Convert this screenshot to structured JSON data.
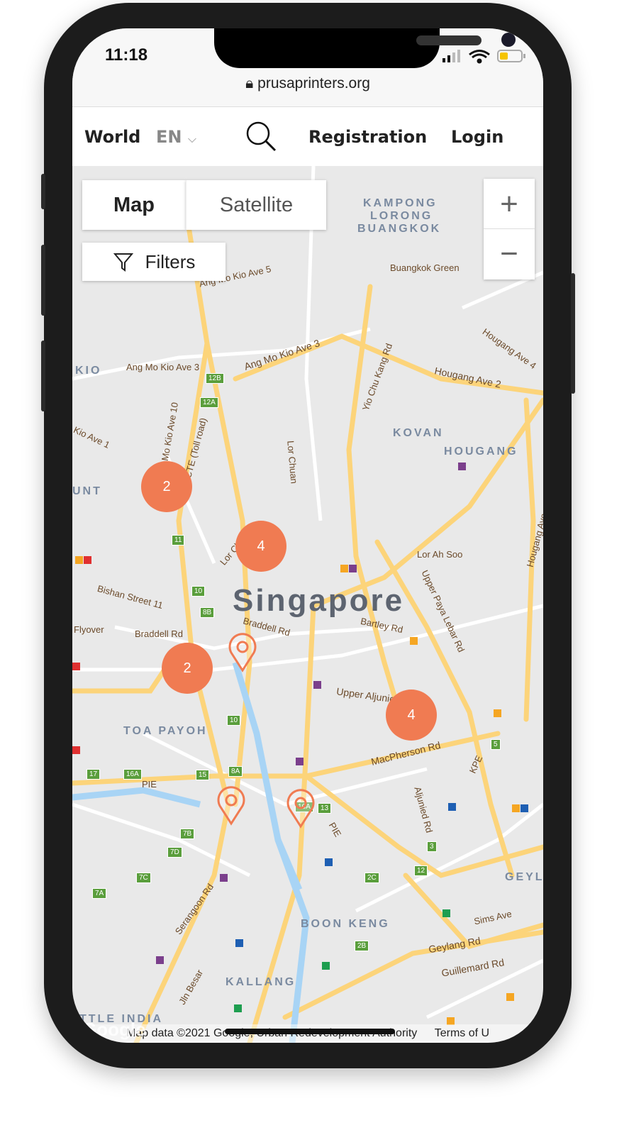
{
  "status": {
    "time": "11:18",
    "battery_color": "#f5c400"
  },
  "browser": {
    "url": "prusaprinters.org"
  },
  "header": {
    "region": "World",
    "language": "EN",
    "registration": "Registration",
    "login": "Login"
  },
  "map_controls": {
    "map": "Map",
    "satellite": "Satellite",
    "filters": "Filters",
    "zoom_in": "+",
    "zoom_out": "−"
  },
  "map": {
    "city": "Singapore",
    "areas": [
      "KAMPONG",
      "LORONG",
      "BUANGKOK",
      "KOVAN",
      "HOUGANG",
      "TOA PAYOH",
      "BOON KENG",
      "KALLANG",
      "GEYL",
      "KIO",
      "UNT",
      "TTLE INDIA"
    ],
    "roads": [
      "Ang Mo Kio Ave 5",
      "Ang Mo Kio Ave 3",
      "Ang Mo Kio Ave 3",
      "Buangkok Green",
      "Hougang Ave 4",
      "Hougang Ave 2",
      "Yio Chu Kang Rd",
      "CTE (Toll road)",
      "Ang Mo Kio Ave 10",
      "Kio Ave 1",
      "Lor Chuan",
      "Lor Chuan",
      "Lor Ah Soo",
      "Upper Paya Lebar Rd",
      "Hougang Ave",
      "Bishan Street 11",
      "Flyover",
      "Braddell Rd",
      "Braddell Rd",
      "Bartley Rd",
      "Upper Aljunied Rd",
      "MacPherson Rd",
      "KPE",
      "PIE",
      "PIE",
      "Aljunied Rd",
      "Serangoon Rd",
      "Sims Ave",
      "Geylang Rd",
      "Guillemard Rd",
      "Jln Besar"
    ],
    "exits": [
      "12B",
      "12A",
      "11",
      "10",
      "8B",
      "10",
      "15",
      "8A",
      "17",
      "16A",
      "7B",
      "7D",
      "7C",
      "7A",
      "13",
      "16A",
      "2C",
      "2B",
      "12",
      "3",
      "5"
    ],
    "clusters": [
      {
        "count": "2"
      },
      {
        "count": "4"
      },
      {
        "count": "2"
      },
      {
        "count": "4"
      }
    ],
    "marker_color": "#f07b52",
    "attribution": "Map data ©2021 Google, Urban Redevelopment Authority",
    "terms": "Terms of U",
    "logo": "Google"
  }
}
